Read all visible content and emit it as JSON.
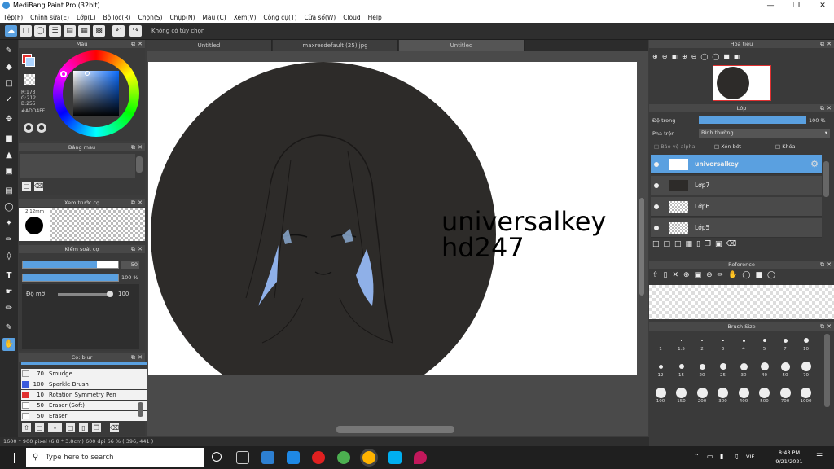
{
  "app": {
    "title": "MediBang Paint Pro (32bit)"
  },
  "menu": [
    "Tệp(F)",
    "Chỉnh sửa(E)",
    "Lớp(L)",
    "Bộ lọc(R)",
    "Chọn(S)",
    "Chụp(N)",
    "Màu (C)",
    "Xem(V)",
    "Công cụ(T)",
    "Cửa sổ(W)",
    "Cloud",
    "Help"
  ],
  "toolbar": {
    "message": "Không có tùy chọn"
  },
  "tabs": [
    "Untitled",
    "maxresdefault (25).jpg",
    "Untitled"
  ],
  "color_panel": {
    "title": "Màu",
    "r": "R:173",
    "g": "G:212",
    "b": "B:255",
    "hex": "#ADD4FF",
    "accent": "#ADD4FF"
  },
  "palette_panel": {
    "title": "Bảng màu",
    "empty": "---"
  },
  "preview_panel": {
    "title": "Xem trước cọ",
    "size": "2.12mm"
  },
  "brush_control": {
    "title": "Kiểm soát cọ",
    "size": "50",
    "opacity": "100 %",
    "density_label": "Độ mờ",
    "density": "100",
    "size_fraction": 0.78,
    "opacity_fraction": 1.0
  },
  "brush_list": {
    "title": "Cọ: blur",
    "items": [
      {
        "n": "70",
        "name": "Smudge",
        "color": "#f0f0f0"
      },
      {
        "n": "100",
        "name": "Sparkle Brush",
        "color": "#3a5adb"
      },
      {
        "n": "10",
        "name": "Rotation Symmetry Pen",
        "color": "#e03030"
      },
      {
        "n": "50",
        "name": "Eraser (Soft)",
        "color": "#ffffff"
      },
      {
        "n": "50",
        "name": "Eraser",
        "color": "#ffffff"
      }
    ]
  },
  "canvas": {
    "text_line1": "universalkey",
    "text_line2": "hd247"
  },
  "status": {
    "text": "1600 * 900 pixel  (6.8 * 3.8cm)  600 dpi  66 %  ( 396, 441 )"
  },
  "navigator": {
    "title": "Hoa tiêu"
  },
  "layer_panel": {
    "title": "Lớp",
    "opacity_label": "Độ trong",
    "opacity_value": "100 %",
    "blend_label": "Pha trộn",
    "blend_value": "Bình thường",
    "protect_alpha": "Bảo vệ alpha",
    "clipping": "Xén bớt",
    "lock": "Khóa",
    "layers": [
      {
        "name": "universalkey",
        "selected": true
      },
      {
        "name": "Lớp7",
        "selected": false
      },
      {
        "name": "Lớp6",
        "selected": false
      },
      {
        "name": "Lớp5",
        "selected": false
      }
    ]
  },
  "reference": {
    "title": "Reference"
  },
  "brush_size": {
    "title": "Brush Size",
    "row1": [
      "1",
      "1.5",
      "2",
      "3",
      "4",
      "5",
      "7",
      "10"
    ],
    "row2": [
      "12",
      "15",
      "20",
      "25",
      "30",
      "40",
      "50",
      "70"
    ],
    "row3": [
      "100",
      "150",
      "200",
      "300",
      "400",
      "500",
      "700",
      "1000"
    ]
  },
  "taskbar": {
    "search_placeholder": "Type here to search",
    "time": "8:43 PM",
    "date": "9/21/2021",
    "lang": "VIE"
  }
}
